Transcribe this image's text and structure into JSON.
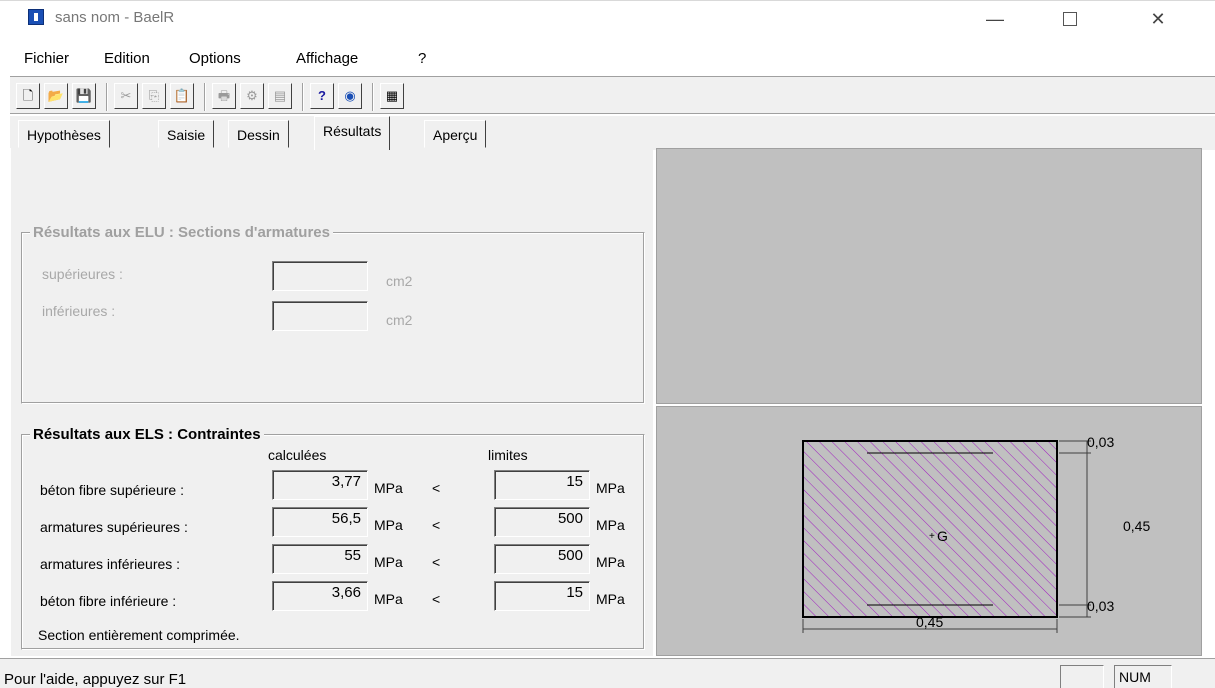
{
  "window": {
    "title": "sans nom - BaelR"
  },
  "menu": [
    "Fichier",
    "Edition",
    "Options",
    "Affichage",
    "?"
  ],
  "tabs": [
    "Hypothèses",
    "Saisie",
    "Dessin",
    "Résultats",
    "Aperçu"
  ],
  "active_tab": "Résultats",
  "elu": {
    "title": "Résultats aux ELU : Sections d'armatures",
    "rows": [
      {
        "label": "supérieures :",
        "value": "",
        "unit": "cm2"
      },
      {
        "label": "inférieures :",
        "value": "",
        "unit": "cm2"
      }
    ]
  },
  "els": {
    "title": "Résultats aux ELS : Contraintes",
    "col_calc": "calculées",
    "col_lim": "limites",
    "rows": [
      {
        "label": "béton fibre supérieure :",
        "calc": "3,77",
        "unit": "MPa",
        "op": "<",
        "limit": "15",
        "unit2": "MPa"
      },
      {
        "label": "armatures supérieures :",
        "calc": "56,5",
        "unit": "MPa",
        "op": "<",
        "limit": "500",
        "unit2": "MPa"
      },
      {
        "label": "armatures inférieures :",
        "calc": "55",
        "unit": "MPa",
        "op": "<",
        "limit": "500",
        "unit2": "MPa"
      },
      {
        "label": "béton fibre inférieure :",
        "calc": "3,66",
        "unit": "MPa",
        "op": "<",
        "limit": "15",
        "unit2": "MPa"
      }
    ],
    "note": "Section entièrement comprimée."
  },
  "section_drawing": {
    "width_label": "0,45",
    "height_label": "0,45",
    "cover_top_label": "0,03",
    "cover_bottom_label": "0,03",
    "centroid_label": "G",
    "hatch_color": "#a020c0"
  },
  "status": {
    "help": "Pour l'aide, appuyez sur F1",
    "num": "NUM"
  }
}
